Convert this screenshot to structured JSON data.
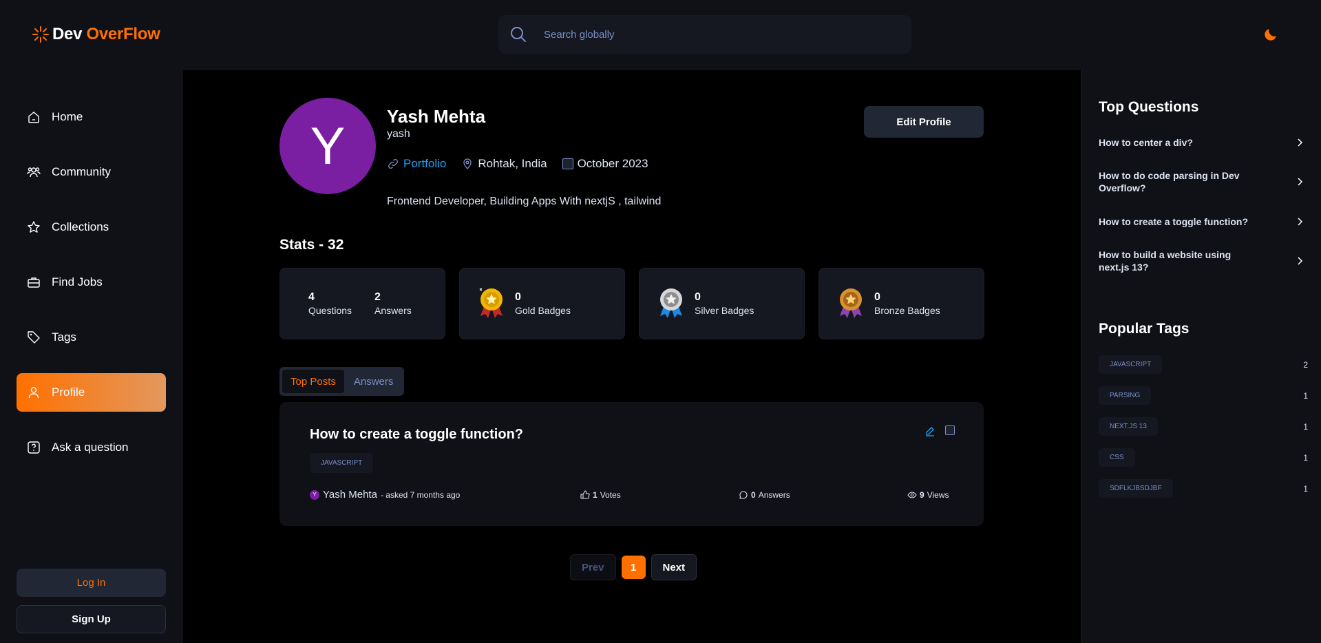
{
  "navbar": {
    "logo_dev": "Dev",
    "logo_over": "OverFlow",
    "search_placeholder": "Search globally"
  },
  "sidebar": {
    "items": [
      {
        "label": "Home",
        "icon": "home-icon"
      },
      {
        "label": "Community",
        "icon": "users-icon"
      },
      {
        "label": "Collections",
        "icon": "star-icon"
      },
      {
        "label": "Find Jobs",
        "icon": "suitcase-icon"
      },
      {
        "label": "Tags",
        "icon": "tag-icon"
      },
      {
        "label": "Profile",
        "icon": "user-icon",
        "active": true
      },
      {
        "label": "Ask a question",
        "icon": "question-icon"
      }
    ],
    "login_label": "Log In",
    "signup_label": "Sign Up"
  },
  "profile": {
    "avatar_letter": "Y",
    "name": "Yash Mehta",
    "username": "yash",
    "portfolio_label": "Portfolio",
    "location": "Rohtak, India",
    "joined": "October 2023",
    "bio": "Frontend Developer, Building Apps With nextjS , tailwind",
    "edit_label": "Edit Profile"
  },
  "stats": {
    "title": "Stats - 32",
    "questions_count": "4",
    "questions_label": "Questions",
    "answers_count": "2",
    "answers_label": "Answers",
    "badges": [
      {
        "count": "0",
        "label": "Gold Badges",
        "color": "#f2b600"
      },
      {
        "count": "0",
        "label": "Silver Badges",
        "color": "#b8b8b8"
      },
      {
        "count": "0",
        "label": "Bronze Badges",
        "color": "#d8932f"
      }
    ]
  },
  "tabs": {
    "top_posts": "Top Posts",
    "answers": "Answers"
  },
  "post": {
    "title": "How to create a toggle function?",
    "tag": "JAVASCRIPT",
    "author_initial": "Y",
    "author": "Yash Mehta",
    "asked": "- asked 7 months ago",
    "votes_count": "1",
    "votes_label": "Votes",
    "answers_count": "0",
    "answers_label": "Answers",
    "views_count": "9",
    "views_label": "Views"
  },
  "pagination": {
    "prev": "Prev",
    "page": "1",
    "next": "Next"
  },
  "right_sidebar": {
    "top_questions_title": "Top Questions",
    "top_questions": [
      "How to center a div?",
      "How to do code parsing in Dev Overflow?",
      "How to create a toggle function?",
      "How to build a website using next.js 13?"
    ],
    "popular_tags_title": "Popular Tags",
    "popular_tags": [
      {
        "name": "JAVASCRIPT",
        "count": "2"
      },
      {
        "name": "PARSING",
        "count": "1"
      },
      {
        "name": "NEXT.JS 13",
        "count": "1"
      },
      {
        "name": "CSS",
        "count": "1"
      },
      {
        "name": "SDFLKJBSDJBF",
        "count": "1"
      }
    ]
  },
  "colors": {
    "accent": "#ff7000",
    "link": "#1da1f2",
    "muted_text": "#7b8ec8"
  }
}
